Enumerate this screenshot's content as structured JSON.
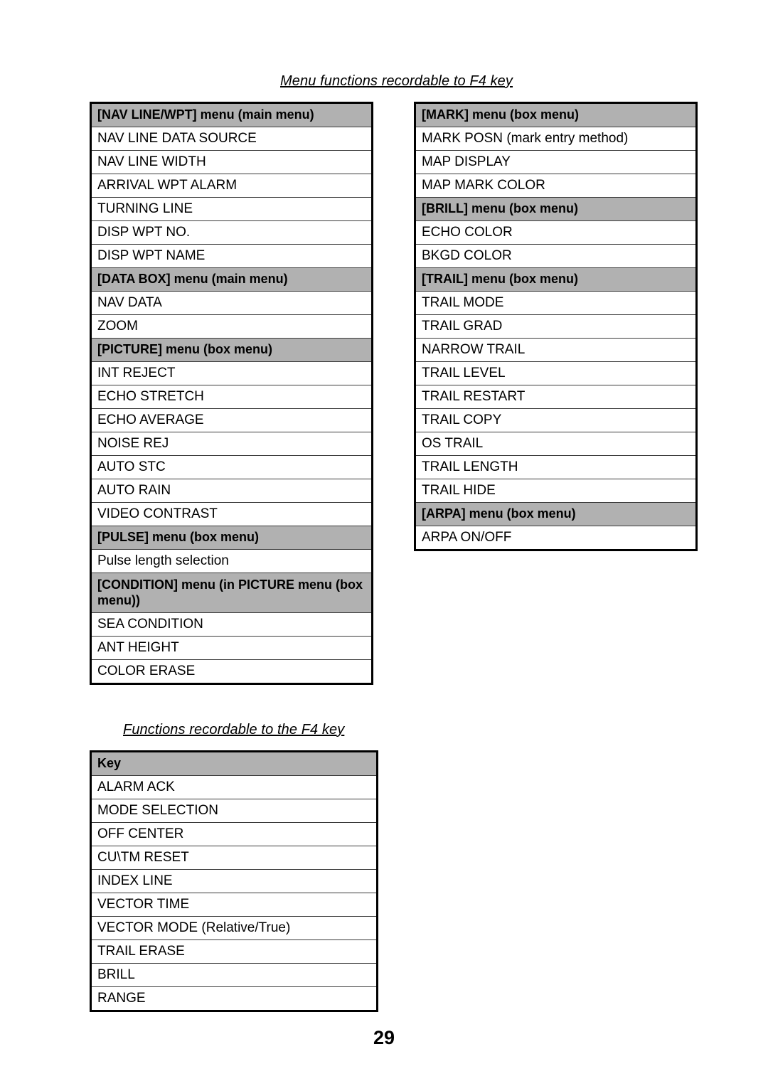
{
  "sections": {
    "menu_functions_title": "Menu functions recordable to F4 key",
    "functions_title": "Functions recordable to the F4 key"
  },
  "menu_table_left": {
    "rows": [
      {
        "type": "header",
        "label": "[NAV LINE/WPT] menu (main menu)"
      },
      {
        "type": "item",
        "label": "NAV LINE DATA SOURCE"
      },
      {
        "type": "item",
        "label": "NAV LINE WIDTH"
      },
      {
        "type": "item",
        "label": "ARRIVAL WPT ALARM"
      },
      {
        "type": "item",
        "label": "TURNING LINE"
      },
      {
        "type": "item",
        "label": "DISP WPT NO."
      },
      {
        "type": "item",
        "label": "DISP WPT NAME"
      },
      {
        "type": "header",
        "label": "[DATA BOX] menu (main menu)"
      },
      {
        "type": "item",
        "label": "NAV DATA"
      },
      {
        "type": "item",
        "label": "ZOOM"
      },
      {
        "type": "header",
        "label": "[PICTURE] menu (box menu)"
      },
      {
        "type": "item",
        "label": "INT REJECT"
      },
      {
        "type": "item",
        "label": "ECHO STRETCH"
      },
      {
        "type": "item",
        "label": "ECHO AVERAGE"
      },
      {
        "type": "item",
        "label": "NOISE REJ"
      },
      {
        "type": "item",
        "label": "AUTO STC"
      },
      {
        "type": "item",
        "label": "AUTO RAIN"
      },
      {
        "type": "item",
        "label": "VIDEO CONTRAST"
      },
      {
        "type": "header",
        "label": "[PULSE] menu (box menu)"
      },
      {
        "type": "item",
        "label": "Pulse length selection"
      },
      {
        "type": "header",
        "label": "[CONDITION] menu (in PICTURE menu (box menu))",
        "wrap": true
      },
      {
        "type": "item",
        "label": "SEA CONDITION"
      },
      {
        "type": "item",
        "label": "ANT HEIGHT"
      },
      {
        "type": "item",
        "label": "COLOR ERASE"
      }
    ]
  },
  "menu_table_right": {
    "rows": [
      {
        "type": "header",
        "label": "[MARK] menu (box menu)"
      },
      {
        "type": "item",
        "label": "MARK POSN ",
        "sub": "(mark entry method)"
      },
      {
        "type": "item",
        "label": "MAP DISPLAY"
      },
      {
        "type": "item",
        "label": "MAP MARK COLOR"
      },
      {
        "type": "header",
        "label": "[BRILL] menu (box menu)"
      },
      {
        "type": "item",
        "label": "ECHO COLOR"
      },
      {
        "type": "item",
        "label": "BKGD COLOR"
      },
      {
        "type": "header",
        "label": "[TRAIL] menu (box menu)"
      },
      {
        "type": "item",
        "label": "TRAIL MODE"
      },
      {
        "type": "item",
        "label": "TRAIL GRAD"
      },
      {
        "type": "item",
        "label": "NARROW TRAIL"
      },
      {
        "type": "item",
        "label": "TRAIL LEVEL"
      },
      {
        "type": "item",
        "label": "TRAIL RESTART"
      },
      {
        "type": "item",
        "label": "TRAIL COPY"
      },
      {
        "type": "item",
        "label": "OS TRAIL"
      },
      {
        "type": "item",
        "label": "TRAIL LENGTH"
      },
      {
        "type": "item",
        "label": "TRAIL HIDE"
      },
      {
        "type": "header",
        "label": "[ARPA] menu (box menu)"
      },
      {
        "type": "item",
        "label": "ARPA ON/OFF"
      }
    ]
  },
  "keys_table": {
    "rows": [
      {
        "type": "header",
        "label": "Key"
      },
      {
        "type": "item",
        "label": "ALARM ACK"
      },
      {
        "type": "item",
        "label": "MODE SELECTION"
      },
      {
        "type": "item",
        "label": "OFF CENTER"
      },
      {
        "type": "item",
        "label": "CU\\TM RESET"
      },
      {
        "type": "item",
        "label": "INDEX LINE"
      },
      {
        "type": "item",
        "label": "VECTOR TIME"
      },
      {
        "type": "item",
        "label": "VECTOR MODE ",
        "sub": "(Relative/True)"
      },
      {
        "type": "item",
        "label": "TRAIL ERASE"
      },
      {
        "type": "item",
        "label": "BRILL"
      },
      {
        "type": "item",
        "label": "RANGE"
      }
    ]
  },
  "footer": {
    "page_number": "29"
  }
}
